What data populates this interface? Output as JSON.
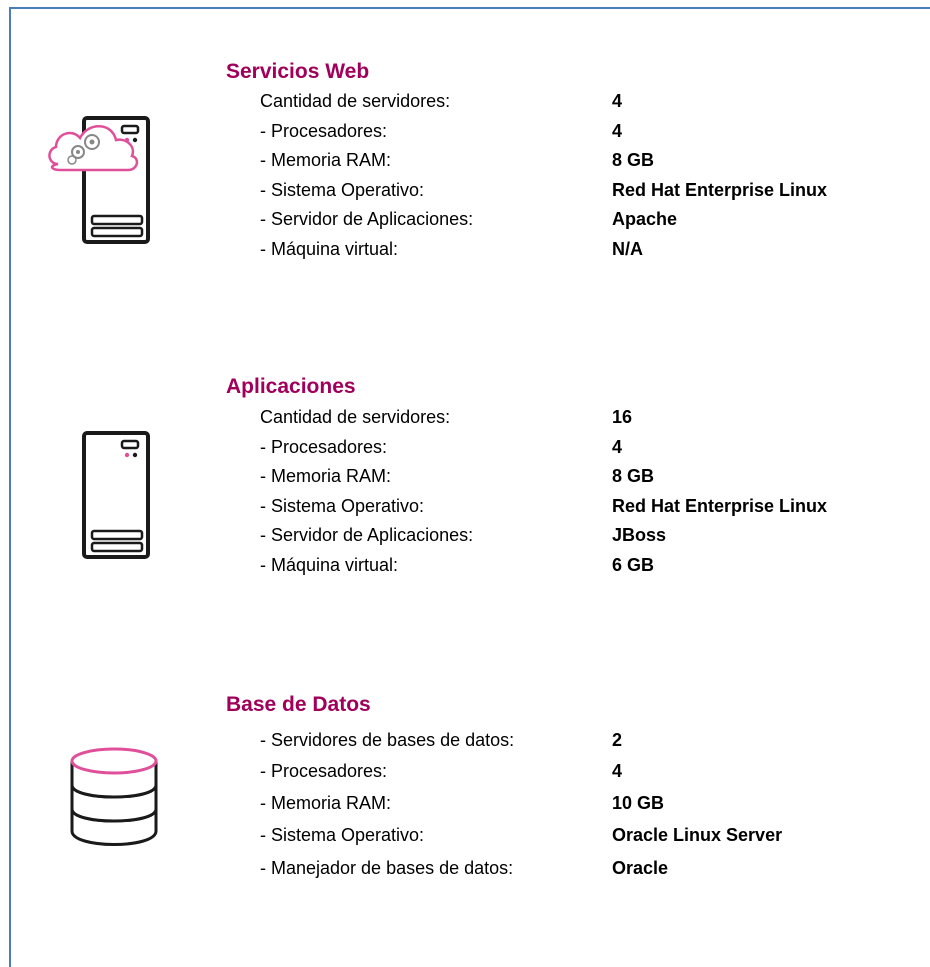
{
  "sections": [
    {
      "title": "Servicios Web",
      "icon": "cloud-server-icon",
      "rows": [
        {
          "label": "Cantidad de servidores:",
          "value": "4"
        },
        {
          "label": "- Procesadores:",
          "value": "4"
        },
        {
          "label": "- Memoria RAM:",
          "value": "8 GB"
        },
        {
          "label": "- Sistema Operativo:",
          "value": "Red Hat Enterprise Linux"
        },
        {
          "label": "- Servidor de Aplicaciones:",
          "value": "Apache"
        },
        {
          "label": "- Máquina virtual:",
          "value": "N/A"
        }
      ]
    },
    {
      "title": "Aplicaciones",
      "icon": "server-tower-icon",
      "rows": [
        {
          "label": "Cantidad de servidores:",
          "value": "16"
        },
        {
          "label": "- Procesadores:",
          "value": "4"
        },
        {
          "label": "- Memoria RAM:",
          "value": "8 GB"
        },
        {
          "label": "- Sistema Operativo:",
          "value": "Red Hat Enterprise Linux"
        },
        {
          "label": "- Servidor de Aplicaciones:",
          "value": "JBoss"
        },
        {
          "label": "- Máquina virtual:",
          "value": "6 GB"
        }
      ]
    },
    {
      "title": "Base de Datos",
      "icon": "database-icon",
      "rows": [
        {
          "label": "- Servidores de bases de datos:",
          "value": "2"
        },
        {
          "label": "- Procesadores:",
          "value": "4"
        },
        {
          "label": "- Memoria RAM:",
          "value": "10 GB"
        },
        {
          "label": "- Sistema Operativo:",
          "value": "Oracle Linux Server"
        },
        {
          "label": "- Manejador de bases de datos:",
          "value": "Oracle"
        }
      ]
    }
  ],
  "colors": {
    "title": "#a0005a",
    "accent": "#e0509a",
    "border": "#4a7ebb"
  }
}
